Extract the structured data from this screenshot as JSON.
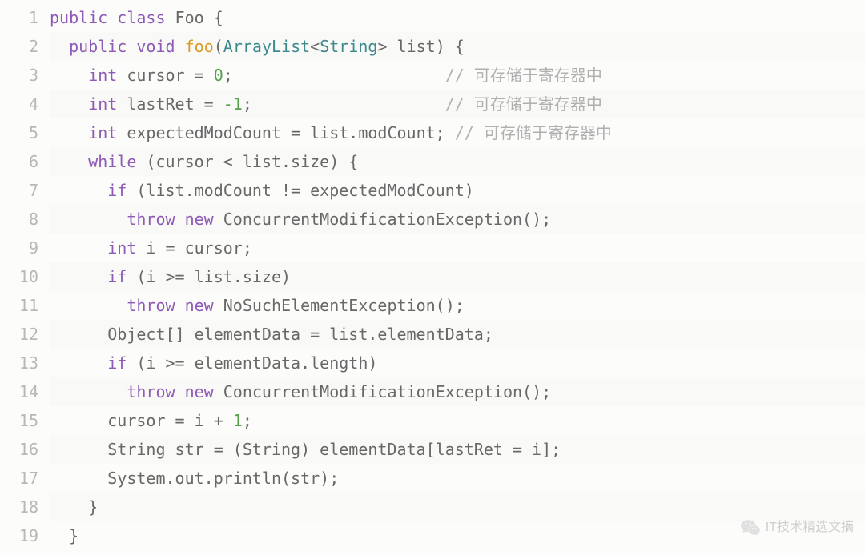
{
  "lines": [
    {
      "n": 1,
      "even": false,
      "tokens": [
        {
          "t": "public",
          "c": "kw"
        },
        {
          "t": " ",
          "c": "pln"
        },
        {
          "t": "class",
          "c": "kw"
        },
        {
          "t": " Foo {",
          "c": "pln"
        }
      ]
    },
    {
      "n": 2,
      "even": true,
      "tokens": [
        {
          "t": "  ",
          "c": "pln"
        },
        {
          "t": "public",
          "c": "kw"
        },
        {
          "t": " ",
          "c": "pln"
        },
        {
          "t": "void",
          "c": "kw"
        },
        {
          "t": " ",
          "c": "pln"
        },
        {
          "t": "foo",
          "c": "fn"
        },
        {
          "t": "(",
          "c": "pln"
        },
        {
          "t": "ArrayList",
          "c": "type"
        },
        {
          "t": "<",
          "c": "pln"
        },
        {
          "t": "String",
          "c": "type"
        },
        {
          "t": "> list) {",
          "c": "pln"
        }
      ]
    },
    {
      "n": 3,
      "even": false,
      "tokens": [
        {
          "t": "    ",
          "c": "pln"
        },
        {
          "t": "int",
          "c": "kw"
        },
        {
          "t": " cursor = ",
          "c": "pln"
        },
        {
          "t": "0",
          "c": "num"
        },
        {
          "t": ";                      ",
          "c": "pln"
        },
        {
          "t": "// 可存储于寄存器中",
          "c": "cmt"
        }
      ]
    },
    {
      "n": 4,
      "even": true,
      "tokens": [
        {
          "t": "    ",
          "c": "pln"
        },
        {
          "t": "int",
          "c": "kw"
        },
        {
          "t": " lastRet = ",
          "c": "pln"
        },
        {
          "t": "-1",
          "c": "num"
        },
        {
          "t": ";                    ",
          "c": "pln"
        },
        {
          "t": "// 可存储于寄存器中",
          "c": "cmt"
        }
      ]
    },
    {
      "n": 5,
      "even": false,
      "tokens": [
        {
          "t": "    ",
          "c": "pln"
        },
        {
          "t": "int",
          "c": "kw"
        },
        {
          "t": " expectedModCount = list.modCount; ",
          "c": "pln"
        },
        {
          "t": "// 可存储于寄存器中",
          "c": "cmt"
        }
      ]
    },
    {
      "n": 6,
      "even": true,
      "tokens": [
        {
          "t": "    ",
          "c": "pln"
        },
        {
          "t": "while",
          "c": "kw"
        },
        {
          "t": " (cursor < list.size) {",
          "c": "pln"
        }
      ]
    },
    {
      "n": 7,
      "even": false,
      "tokens": [
        {
          "t": "      ",
          "c": "pln"
        },
        {
          "t": "if",
          "c": "kw"
        },
        {
          "t": " (list.modCount != expectedModCount)",
          "c": "pln"
        }
      ]
    },
    {
      "n": 8,
      "even": true,
      "tokens": [
        {
          "t": "        ",
          "c": "pln"
        },
        {
          "t": "throw",
          "c": "kw"
        },
        {
          "t": " ",
          "c": "pln"
        },
        {
          "t": "new",
          "c": "kw"
        },
        {
          "t": " ConcurrentModificationException();",
          "c": "pln"
        }
      ]
    },
    {
      "n": 9,
      "even": false,
      "tokens": [
        {
          "t": "      ",
          "c": "pln"
        },
        {
          "t": "int",
          "c": "kw"
        },
        {
          "t": " i = cursor;",
          "c": "pln"
        }
      ]
    },
    {
      "n": 10,
      "even": true,
      "tokens": [
        {
          "t": "      ",
          "c": "pln"
        },
        {
          "t": "if",
          "c": "kw"
        },
        {
          "t": " (i >= list.size)",
          "c": "pln"
        }
      ]
    },
    {
      "n": 11,
      "even": false,
      "tokens": [
        {
          "t": "        ",
          "c": "pln"
        },
        {
          "t": "throw",
          "c": "kw"
        },
        {
          "t": " ",
          "c": "pln"
        },
        {
          "t": "new",
          "c": "kw"
        },
        {
          "t": " NoSuchElementException();",
          "c": "pln"
        }
      ]
    },
    {
      "n": 12,
      "even": true,
      "tokens": [
        {
          "t": "      Object[] elementData = list.elementData;",
          "c": "pln"
        }
      ]
    },
    {
      "n": 13,
      "even": false,
      "tokens": [
        {
          "t": "      ",
          "c": "pln"
        },
        {
          "t": "if",
          "c": "kw"
        },
        {
          "t": " (i >= elementData.length)",
          "c": "pln"
        }
      ]
    },
    {
      "n": 14,
      "even": true,
      "tokens": [
        {
          "t": "        ",
          "c": "pln"
        },
        {
          "t": "throw",
          "c": "kw"
        },
        {
          "t": " ",
          "c": "pln"
        },
        {
          "t": "new",
          "c": "kw"
        },
        {
          "t": " ConcurrentModificationException();",
          "c": "pln"
        }
      ]
    },
    {
      "n": 15,
      "even": false,
      "tokens": [
        {
          "t": "      cursor = i + ",
          "c": "pln"
        },
        {
          "t": "1",
          "c": "num"
        },
        {
          "t": ";",
          "c": "pln"
        }
      ]
    },
    {
      "n": 16,
      "even": true,
      "tokens": [
        {
          "t": "      String str = (String) elementData[lastRet = i];",
          "c": "pln"
        }
      ]
    },
    {
      "n": 17,
      "even": false,
      "tokens": [
        {
          "t": "      System.out.println(str);",
          "c": "pln"
        }
      ]
    },
    {
      "n": 18,
      "even": true,
      "tokens": [
        {
          "t": "    }",
          "c": "pln"
        }
      ]
    },
    {
      "n": 19,
      "even": false,
      "tokens": [
        {
          "t": "  }",
          "c": "pln"
        }
      ]
    }
  ],
  "watermark": "IT技术精选文摘"
}
